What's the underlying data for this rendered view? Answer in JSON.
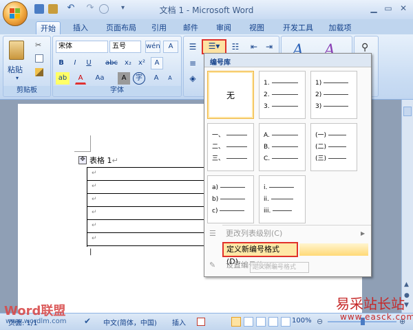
{
  "window": {
    "title": "文档 1 - Microsoft Word"
  },
  "colors": {
    "accent_red": "#e0302a",
    "ribbon": "#c9dcf3",
    "highlight": "#ffe8a6"
  },
  "tabs": [
    "开始",
    "插入",
    "页面布局",
    "引用",
    "邮件",
    "审阅",
    "视图",
    "开发工具",
    "加载项"
  ],
  "ribbon": {
    "clipboard": {
      "paste_label": "粘贴",
      "group_label": "剪贴板"
    },
    "font": {
      "font_name": "宋体",
      "font_size": "五号",
      "wen": "wén",
      "bold": "B",
      "italic": "I",
      "underline": "U",
      "strike": "abc",
      "subscript": "x₂",
      "superscript": "x²",
      "clear": "A",
      "highlight": "ab",
      "color": "A",
      "case": "Aa",
      "shade": "A",
      "circle": "字",
      "grow": "A",
      "shrink": "A",
      "group_label": "字体"
    }
  },
  "numbering_menu": {
    "header": "编号库",
    "cells": [
      {
        "label": "无"
      },
      {
        "lines": [
          "1.",
          "2.",
          "3."
        ]
      },
      {
        "lines": [
          "1)",
          "2)",
          "3)"
        ]
      },
      {
        "lines": [
          "一、",
          "二、",
          "三、"
        ]
      },
      {
        "lines": [
          "A.",
          "B.",
          "C."
        ]
      },
      {
        "lines": [
          "(一)",
          "(二)",
          "(三)"
        ]
      },
      {
        "lines": [
          "a)",
          "b)",
          "c)"
        ]
      },
      {
        "lines": [
          "i.",
          "ii.",
          "iii."
        ]
      }
    ],
    "items": {
      "change_level": "更改列表级别(C)",
      "define_new": "定义新编号格式(D)...",
      "set_value": "设置编号值(V)..."
    },
    "tooltip": "定义新编号格式"
  },
  "document": {
    "table_caption": "表格 1",
    "para_mark": "↵"
  },
  "status": {
    "page": "页面: 1/1",
    "language": "中文(简体，中国)",
    "insert_mode": "插入",
    "zoom": "100%"
  },
  "watermarks": {
    "left_logo": "Word联盟",
    "left_url": "www.wordlm.com",
    "right_logo": "易采站长站",
    "right_url": "www.easck.com"
  }
}
